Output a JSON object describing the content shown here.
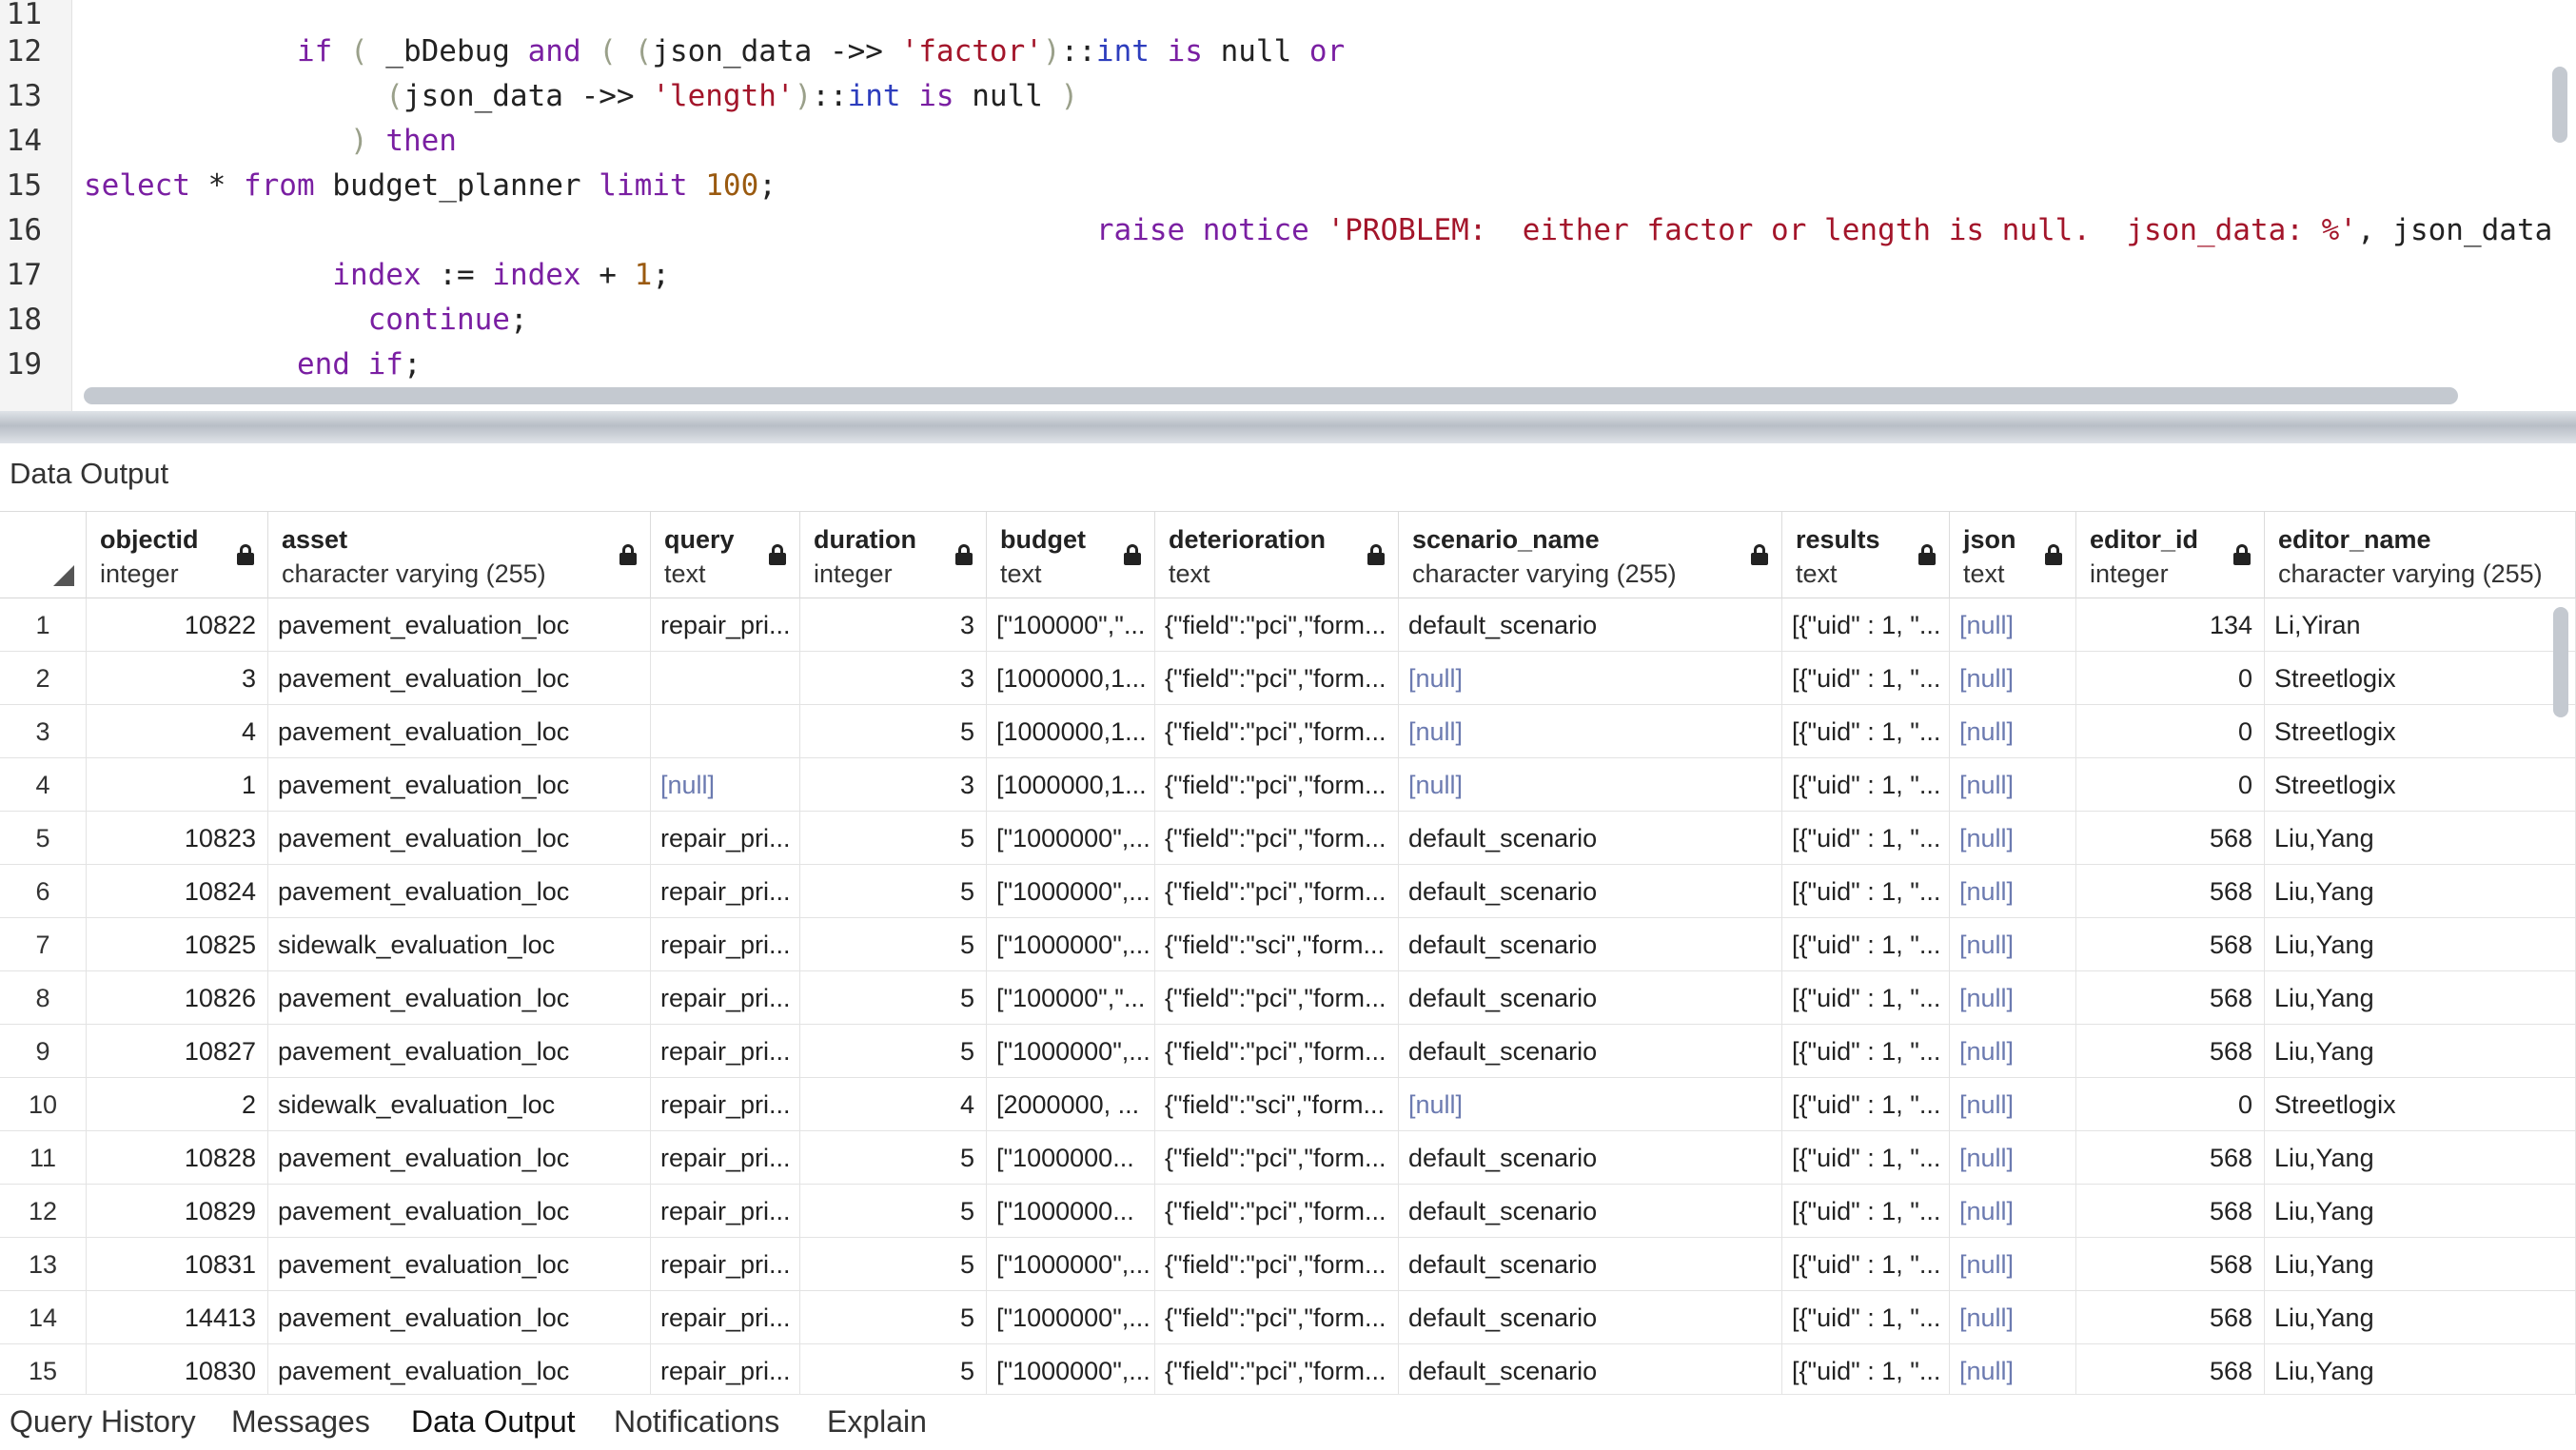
{
  "editor": {
    "lines": [
      {
        "n": "11",
        "tokens": []
      },
      {
        "n": "12",
        "tokens": [
          [
            "",
            "            "
          ],
          [
            "kw",
            "if"
          ],
          [
            "",
            " "
          ],
          [
            "pn",
            "("
          ],
          [
            "",
            " _bDebug "
          ],
          [
            "kw",
            "and"
          ],
          [
            "",
            " "
          ],
          [
            "pn",
            "("
          ],
          [
            "",
            " "
          ],
          [
            "pn",
            "("
          ],
          [
            "",
            "json_data ->> "
          ],
          [
            "str",
            "'factor'"
          ],
          [
            "pn",
            ")"
          ],
          [
            "",
            "::"
          ],
          [
            "ty",
            "int"
          ],
          [
            "",
            " "
          ],
          [
            "kw",
            "is"
          ],
          [
            "",
            " null "
          ],
          [
            "kw",
            "or"
          ]
        ]
      },
      {
        "n": "13",
        "tokens": [
          [
            "",
            "                 "
          ],
          [
            "pn",
            "("
          ],
          [
            "",
            "json_data ->> "
          ],
          [
            "str",
            "'length'"
          ],
          [
            "pn",
            ")"
          ],
          [
            "",
            "::"
          ],
          [
            "ty",
            "int"
          ],
          [
            "",
            " "
          ],
          [
            "kw",
            "is"
          ],
          [
            "",
            " null "
          ],
          [
            "pn",
            ")"
          ]
        ]
      },
      {
        "n": "14",
        "tokens": [
          [
            "",
            "               "
          ],
          [
            "pn",
            ")"
          ],
          [
            "",
            " "
          ],
          [
            "kw",
            "then"
          ]
        ]
      },
      {
        "n": "15",
        "tokens": [
          [
            "kw",
            "select"
          ],
          [
            "",
            " * "
          ],
          [
            "kw",
            "from"
          ],
          [
            "",
            " budget_planner "
          ],
          [
            "kw",
            "limit"
          ],
          [
            "",
            " "
          ],
          [
            "num",
            "100"
          ],
          [
            "",
            ";"
          ]
        ]
      },
      {
        "n": "16",
        "tokens": [
          [
            "",
            "                                                         "
          ],
          [
            "kw",
            "raise notice"
          ],
          [
            "",
            " "
          ],
          [
            "str",
            "'PROBLEM:  either factor or length is null.  json_data: %'"
          ],
          [
            "",
            ", json_data"
          ]
        ]
      },
      {
        "n": "17",
        "tokens": [
          [
            "",
            "              "
          ],
          [
            "kw",
            "index"
          ],
          [
            "",
            " := "
          ],
          [
            "kw",
            "index"
          ],
          [
            "",
            " + "
          ],
          [
            "num",
            "1"
          ],
          [
            "",
            ";"
          ]
        ]
      },
      {
        "n": "18",
        "tokens": [
          [
            "",
            "                "
          ],
          [
            "kw",
            "continue"
          ],
          [
            "",
            ";"
          ]
        ]
      },
      {
        "n": "19",
        "tokens": [
          [
            "",
            "            "
          ],
          [
            "kw",
            "end if"
          ],
          [
            "",
            ";"
          ]
        ]
      }
    ]
  },
  "panel": {
    "title": "Data Output"
  },
  "grid": {
    "columns": [
      {
        "name": "objectid",
        "type": "integer",
        "align": "right"
      },
      {
        "name": "asset",
        "type": "character varying (255)",
        "align": "left"
      },
      {
        "name": "query",
        "type": "text",
        "align": "left"
      },
      {
        "name": "duration",
        "type": "integer",
        "align": "right"
      },
      {
        "name": "budget",
        "type": "text",
        "align": "left"
      },
      {
        "name": "deterioration",
        "type": "text",
        "align": "left"
      },
      {
        "name": "scenario_name",
        "type": "character varying (255)",
        "align": "left"
      },
      {
        "name": "results",
        "type": "text",
        "align": "left"
      },
      {
        "name": "json",
        "type": "text",
        "align": "left"
      },
      {
        "name": "editor_id",
        "type": "integer",
        "align": "right"
      },
      {
        "name": "editor_name",
        "type": "character varying (255)",
        "align": "left"
      }
    ],
    "rows": [
      [
        "1",
        "10822",
        "pavement_evaluation_loc",
        "repair_pri...",
        "3",
        "[\"100000\",\"...",
        "{\"field\":\"pci\",\"form...",
        "default_scenario",
        "[{\"uid\" : 1, \"...",
        "[null]",
        "134",
        "Li,Yiran"
      ],
      [
        "2",
        "3",
        "pavement_evaluation_loc",
        "",
        "3",
        "[1000000,1...",
        "{\"field\":\"pci\",\"form...",
        "[null]",
        "[{\"uid\" : 1, \"...",
        "[null]",
        "0",
        "Streetlogix"
      ],
      [
        "3",
        "4",
        "pavement_evaluation_loc",
        "",
        "5",
        "[1000000,1...",
        "{\"field\":\"pci\",\"form...",
        "[null]",
        "[{\"uid\" : 1, \"...",
        "[null]",
        "0",
        "Streetlogix"
      ],
      [
        "4",
        "1",
        "pavement_evaluation_loc",
        "[null]",
        "3",
        "[1000000,1...",
        "{\"field\":\"pci\",\"form...",
        "[null]",
        "[{\"uid\" : 1, \"...",
        "[null]",
        "0",
        "Streetlogix"
      ],
      [
        "5",
        "10823",
        "pavement_evaluation_loc",
        "repair_pri...",
        "5",
        "[\"1000000\",...",
        "{\"field\":\"pci\",\"form...",
        "default_scenario",
        "[{\"uid\" : 1, \"...",
        "[null]",
        "568",
        "Liu,Yang"
      ],
      [
        "6",
        "10824",
        "pavement_evaluation_loc",
        "repair_pri...",
        "5",
        "[\"1000000\",...",
        "{\"field\":\"pci\",\"form...",
        "default_scenario",
        "[{\"uid\" : 1, \"...",
        "[null]",
        "568",
        "Liu,Yang"
      ],
      [
        "7",
        "10825",
        "sidewalk_evaluation_loc",
        "repair_pri...",
        "5",
        "[\"1000000\",...",
        "{\"field\":\"sci\",\"form...",
        "default_scenario",
        "[{\"uid\" : 1, \"...",
        "[null]",
        "568",
        "Liu,Yang"
      ],
      [
        "8",
        "10826",
        "pavement_evaluation_loc",
        "repair_pri...",
        "5",
        "[\"100000\",\"...",
        "{\"field\":\"pci\",\"form...",
        "default_scenario",
        "[{\"uid\" : 1, \"...",
        "[null]",
        "568",
        "Liu,Yang"
      ],
      [
        "9",
        "10827",
        "pavement_evaluation_loc",
        "repair_pri...",
        "5",
        "[\"1000000\",...",
        "{\"field\":\"pci\",\"form...",
        "default_scenario",
        "[{\"uid\" : 1, \"...",
        "[null]",
        "568",
        "Liu,Yang"
      ],
      [
        "10",
        "2",
        "sidewalk_evaluation_loc",
        "repair_pri...",
        "4",
        "[2000000, ...",
        "{\"field\":\"sci\",\"form...",
        "[null]",
        "[{\"uid\" : 1, \"...",
        "[null]",
        "0",
        "Streetlogix"
      ],
      [
        "11",
        "10828",
        "pavement_evaluation_loc",
        "repair_pri...",
        "5",
        "[\"1000000...",
        "{\"field\":\"pci\",\"form...",
        "default_scenario",
        "[{\"uid\" : 1, \"...",
        "[null]",
        "568",
        "Liu,Yang"
      ],
      [
        "12",
        "10829",
        "pavement_evaluation_loc",
        "repair_pri...",
        "5",
        "[\"1000000...",
        "{\"field\":\"pci\",\"form...",
        "default_scenario",
        "[{\"uid\" : 1, \"...",
        "[null]",
        "568",
        "Liu,Yang"
      ],
      [
        "13",
        "10831",
        "pavement_evaluation_loc",
        "repair_pri...",
        "5",
        "[\"1000000\",...",
        "{\"field\":\"pci\",\"form...",
        "default_scenario",
        "[{\"uid\" : 1, \"...",
        "[null]",
        "568",
        "Liu,Yang"
      ],
      [
        "14",
        "14413",
        "pavement_evaluation_loc",
        "repair_pri...",
        "5",
        "[\"1000000\",...",
        "{\"field\":\"pci\",\"form...",
        "default_scenario",
        "[{\"uid\" : 1, \"...",
        "[null]",
        "568",
        "Liu,Yang"
      ],
      [
        "15",
        "10830",
        "pavement_evaluation_loc",
        "repair_pri...",
        "5",
        "[\"1000000\",...",
        "{\"field\":\"pci\",\"form...",
        "default_scenario",
        "[{\"uid\" : 1, \"...",
        "[null]",
        "568",
        "Liu,Yang"
      ]
    ]
  },
  "tabs": [
    {
      "label": "Query History",
      "active": false
    },
    {
      "label": "Messages",
      "active": false
    },
    {
      "label": "Data Output",
      "active": true
    },
    {
      "label": "Notifications",
      "active": false
    },
    {
      "label": "Explain",
      "active": false
    }
  ],
  "colors": {
    "keyword": "#7a1fa2",
    "type": "#2d3dbd",
    "string": "#a3152a",
    "number": "#9a5a10",
    "null_value": "#6b7ab0"
  }
}
